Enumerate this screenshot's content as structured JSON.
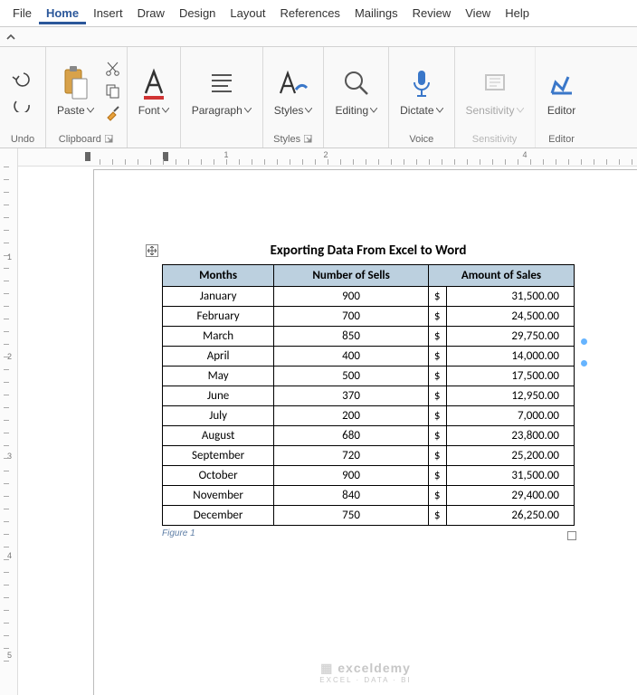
{
  "menu": {
    "items": [
      "File",
      "Home",
      "Insert",
      "Draw",
      "Design",
      "Layout",
      "References",
      "Mailings",
      "Review",
      "View",
      "Help"
    ],
    "active": "Home"
  },
  "ribbon": {
    "undo": {
      "label": "Undo"
    },
    "clipboard": {
      "paste": "Paste",
      "label": "Clipboard"
    },
    "font": {
      "btn": "Font"
    },
    "paragraph": {
      "btn": "Paragraph"
    },
    "styles": {
      "btn": "Styles",
      "label": "Styles"
    },
    "editing": {
      "btn": "Editing"
    },
    "dictate": {
      "btn": "Dictate",
      "label": "Voice"
    },
    "sensitivity": {
      "btn": "Sensitivity",
      "label": "Sensitivity"
    },
    "editor": {
      "btn": "Editor",
      "label": "Editor"
    }
  },
  "document": {
    "title": "Exporting Data From Excel to Word",
    "headers": [
      "Months",
      "Number of Sells",
      "Amount of Sales"
    ],
    "rows": [
      {
        "month": "January",
        "sells": "900",
        "currency": "$",
        "amount": "31,500.00"
      },
      {
        "month": "February",
        "sells": "700",
        "currency": "$",
        "amount": "24,500.00"
      },
      {
        "month": "March",
        "sells": "850",
        "currency": "$",
        "amount": "29,750.00"
      },
      {
        "month": "April",
        "sells": "400",
        "currency": "$",
        "amount": "14,000.00"
      },
      {
        "month": "May",
        "sells": "500",
        "currency": "$",
        "amount": "17,500.00"
      },
      {
        "month": "June",
        "sells": "370",
        "currency": "$",
        "amount": "12,950.00"
      },
      {
        "month": "July",
        "sells": "200",
        "currency": "$",
        "amount": "7,000.00"
      },
      {
        "month": "August",
        "sells": "680",
        "currency": "$",
        "amount": "23,800.00"
      },
      {
        "month": "September",
        "sells": "720",
        "currency": "$",
        "amount": "25,200.00"
      },
      {
        "month": "October",
        "sells": "900",
        "currency": "$",
        "amount": "31,500.00"
      },
      {
        "month": "November",
        "sells": "840",
        "currency": "$",
        "amount": "29,400.00"
      },
      {
        "month": "December",
        "sells": "750",
        "currency": "$",
        "amount": "26,250.00"
      }
    ],
    "caption": "Figure 1"
  },
  "ruler": {
    "h_numbers": [
      "1",
      "2",
      "4"
    ],
    "v_numbers": [
      "1",
      "2",
      "3",
      "4",
      "5"
    ]
  },
  "watermark": {
    "brand": "exceldemy",
    "sub": "EXCEL · DATA · BI"
  }
}
